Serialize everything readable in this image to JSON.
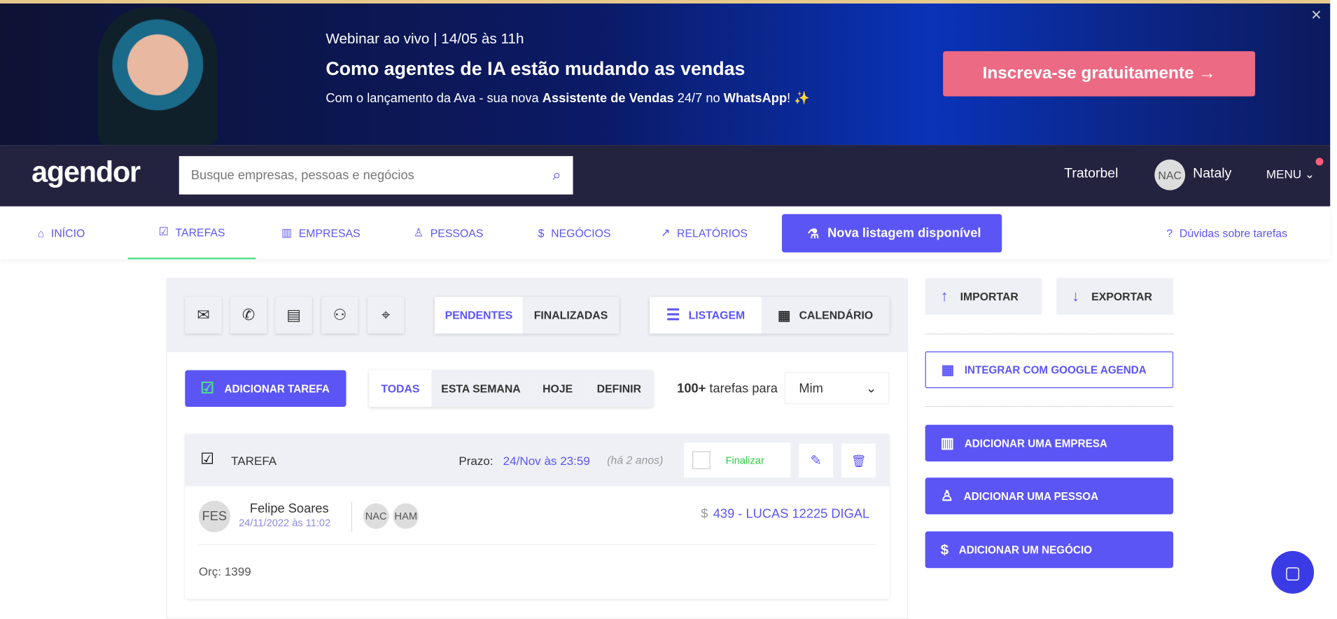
{
  "banner": {
    "line1": "Webinar ao vivo | 14/05 às 11h",
    "title": "Como agentes de IA estão mudando as vendas",
    "subtitle_pre": "Com o lançamento da Ava - sua nova ",
    "subtitle_b1": "Assistente de Vendas",
    "subtitle_mid": " 24/7 no ",
    "subtitle_b2": "WhatsApp",
    "subtitle_post": "! ✨",
    "cta": "Inscreva-se gratuitamente →",
    "close": "✕"
  },
  "header": {
    "logo": "agendor",
    "search_placeholder": "Busque empresas, pessoas e negócios",
    "company": "Tratorbel",
    "avatar": "NAC",
    "user": "Nataly",
    "menu": "MENU"
  },
  "nav": {
    "items": [
      "INÍCIO",
      "TAREFAS",
      "EMPRESAS",
      "PESSOAS",
      "NEGÓCIOS",
      "RELATÓRIOS"
    ],
    "new_listing": "Nova listagem disponível",
    "help": "Dúvidas sobre tarefas"
  },
  "toolbar": {
    "status_tabs": [
      "PENDENTES",
      "FINALIZADAS"
    ],
    "view_tabs": [
      "LISTAGEM",
      "CALENDÁRIO"
    ]
  },
  "filters": {
    "add_task": "ADICIONAR TAREFA",
    "periods": [
      "TODAS",
      "ESTA SEMANA",
      "HOJE",
      "DEFINIR"
    ],
    "count": "100+",
    "count_text": "tarefas para",
    "assignee": "Mim"
  },
  "task": {
    "type": "TAREFA",
    "deadline_label": "Prazo:",
    "deadline": "24/Nov às 23:59",
    "ago": "(há 2 anos)",
    "finalize": "Finalizar",
    "author_initials": "FES",
    "author": "Felipe Soares",
    "created": "24/11/2022 às 11:02",
    "participants": [
      "NAC",
      "HAM"
    ],
    "deal": "439 - LUCAS 12225 DIGAL",
    "description": "Orç: 1399"
  },
  "sidebar": {
    "import": "IMPORTAR",
    "export": "EXPORTAR",
    "google": "INTEGRAR COM GOOGLE AGENDA",
    "add_company": "ADICIONAR UMA EMPRESA",
    "add_person": "ADICIONAR UMA PESSOA",
    "add_deal": "ADICIONAR UM NEGÓCIO"
  }
}
